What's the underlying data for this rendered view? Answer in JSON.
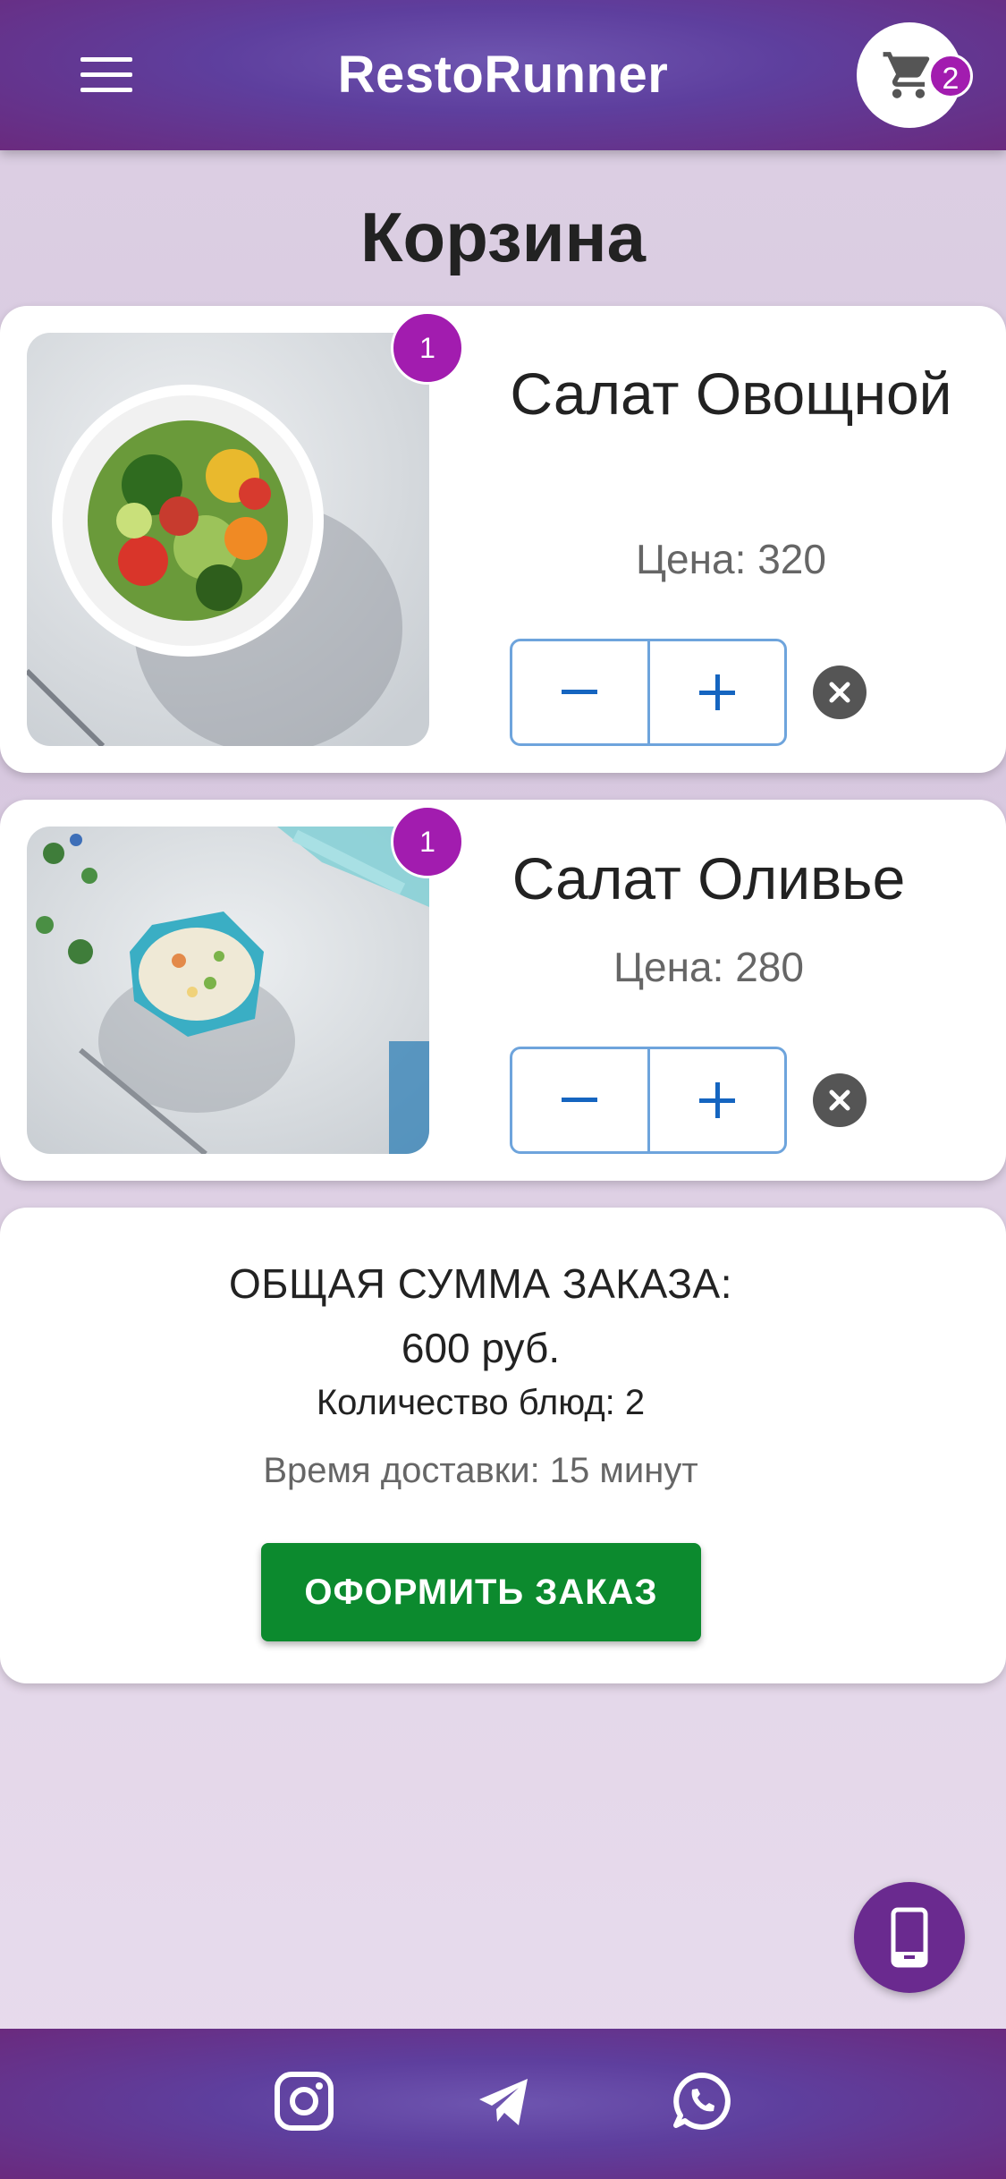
{
  "header": {
    "title": "RestoRunner",
    "cart_count": "2"
  },
  "page": {
    "title": "Корзина"
  },
  "cart_items": [
    {
      "name": "Салат Овощной",
      "price": "Цена: 320",
      "quantity": "1",
      "image": "vegetable-salad-photo"
    },
    {
      "name": "Салат Оливье",
      "price": "Цена: 280",
      "quantity": "1",
      "image": "olivier-salad-photo"
    }
  ],
  "summary": {
    "total_label": "ОБЩАЯ СУММА ЗАКАЗА:",
    "total_value": "600 руб.",
    "dish_count": "Количество блюд: 2",
    "delivery_time": "Время доставки: 15 минут",
    "order_button": "ОФОРМИТЬ ЗАКАЗ"
  },
  "footer": {
    "icons": [
      "instagram-icon",
      "telegram-icon",
      "whatsapp-icon"
    ]
  },
  "colors": {
    "header": "#5e3f9e",
    "badge": "#a21caf",
    "order_button": "#0c8a2e",
    "stepper_border": "#6ea4dc"
  }
}
